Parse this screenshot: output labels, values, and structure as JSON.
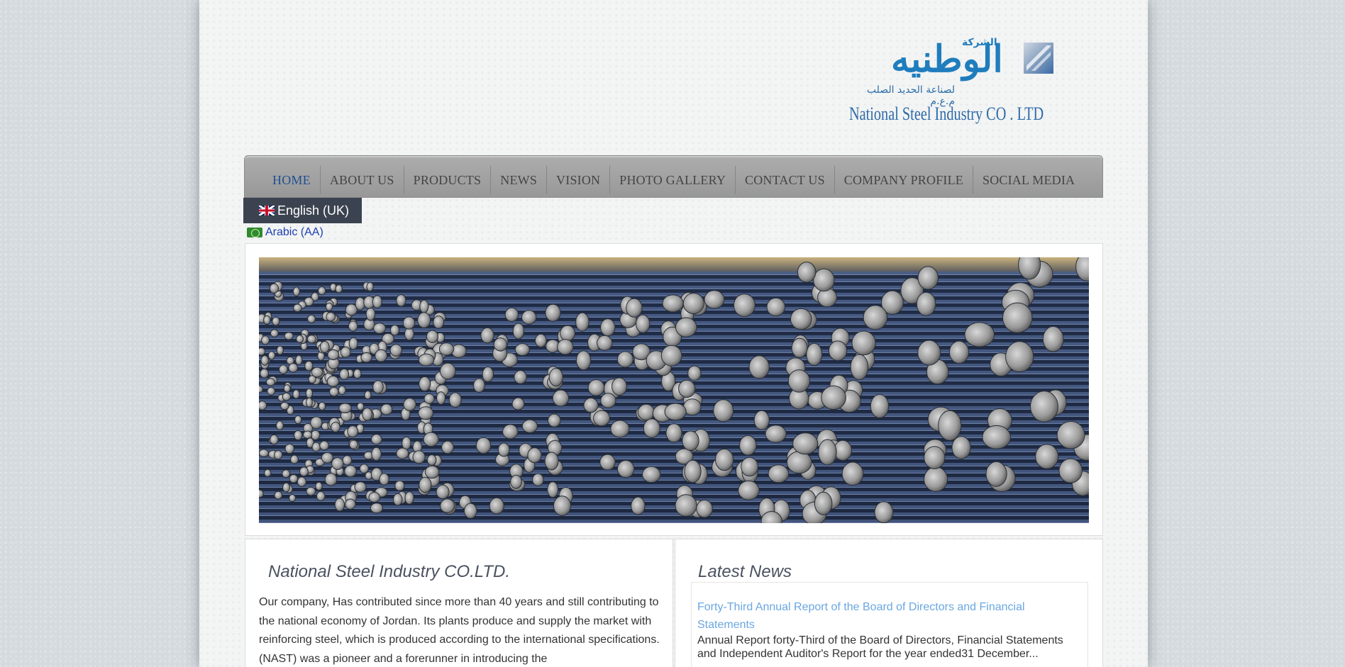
{
  "logo": {
    "arabic_small": "الشركة",
    "arabic_main": "الوطنيه",
    "arabic_sub": "لصناعة الحديد الصلب م.ع.م",
    "english": "National Steel Industry CO . LTD"
  },
  "nav": {
    "items": [
      {
        "label": "HOME",
        "active": true
      },
      {
        "label": "ABOUT US"
      },
      {
        "label": "PRODUCTS"
      },
      {
        "label": "NEWS"
      },
      {
        "label": "VISION"
      },
      {
        "label": "PHOTO GALLERY"
      },
      {
        "label": "CONTACT US"
      },
      {
        "label": "COMPANY PROFILE"
      },
      {
        "label": "SOCIAL MEDIA"
      }
    ]
  },
  "language": {
    "active": "English (UK)",
    "other": "Arabic (AA)"
  },
  "about": {
    "title": "National Steel Industry CO.LTD.",
    "text": "Our company, Has contributed since more than 40 years and still contributing to the national economy of Jordan. Its plants produce and supply the market with reinforcing steel, which is produced according to the international specifications.(NAST) was a pioneer and a forerunner in introducing the"
  },
  "news": {
    "title": "Latest News",
    "items": [
      {
        "title": "Forty-Third Annual Report of the Board of Directors and Financial Statements",
        "summary": "Annual Report forty-Third of the Board of Directors, Financial Statements and Independent Auditor's Report for the year ended31 December..."
      }
    ]
  },
  "colors": {
    "accent": "#1f7dbd",
    "nav_bg": "#a3a3a3",
    "lang_active_bg": "#3c4350",
    "news_link": "#6aa7e0"
  }
}
